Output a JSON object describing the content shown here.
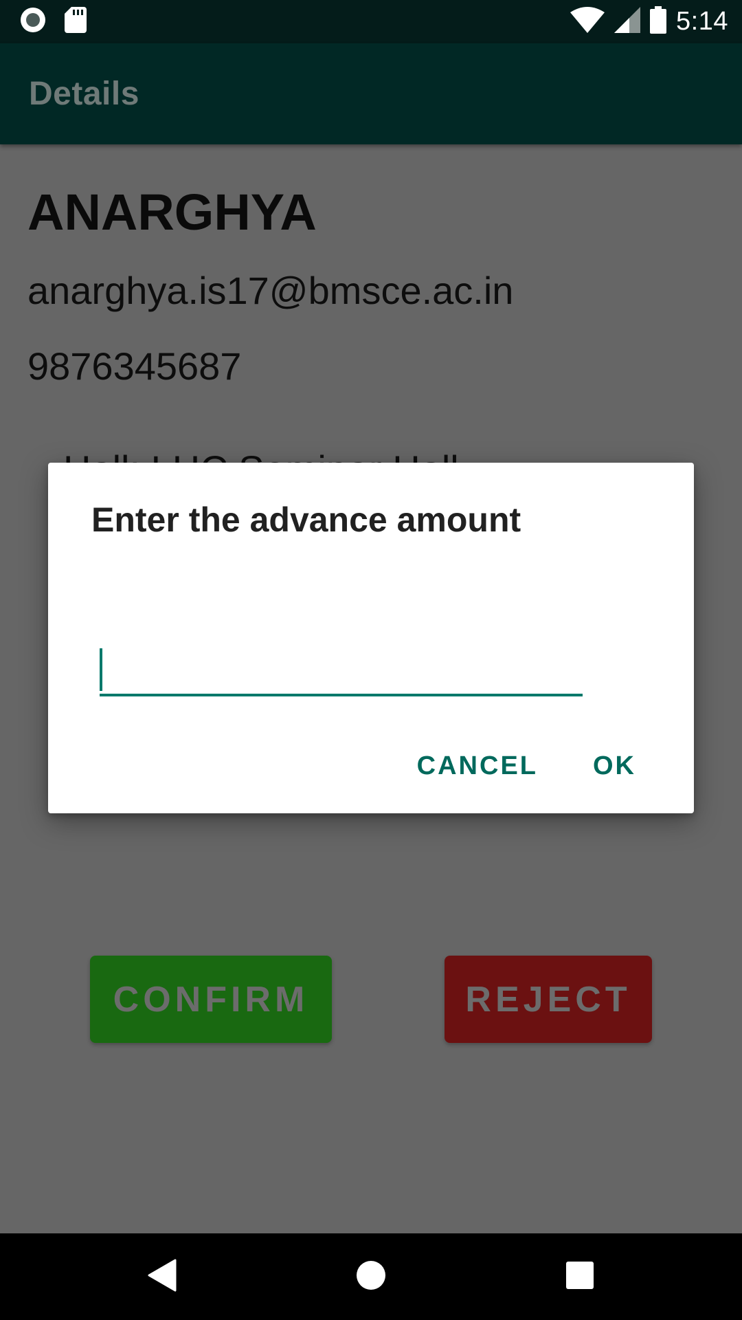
{
  "status_bar": {
    "time": "5:14",
    "icons": [
      "radio-button-icon",
      "sd-card-icon",
      "wifi-icon",
      "signal-icon",
      "battery-icon"
    ]
  },
  "app_bar": {
    "title": "Details"
  },
  "details": {
    "name": "ANARGHYA",
    "email": "anarghya.is17@bmsce.ac.in",
    "phone": "9876345687",
    "hall": "Hall: LHC Seminar Hall"
  },
  "actions": {
    "confirm_label": "CONFIRM",
    "reject_label": "REJECT"
  },
  "dialog": {
    "title": "Enter the advance amount",
    "input_value": "",
    "cancel_label": "CANCEL",
    "ok_label": "OK"
  },
  "nav_bar": {
    "icons": [
      "back-icon",
      "home-icon",
      "recents-icon"
    ]
  },
  "colors": {
    "status_bar_bg": "#041c1a",
    "app_bar_bg": "#012825",
    "accent": "#00695c",
    "confirm_bg": "#196911",
    "reject_bg": "#6b1111",
    "scrim": "#666666"
  }
}
